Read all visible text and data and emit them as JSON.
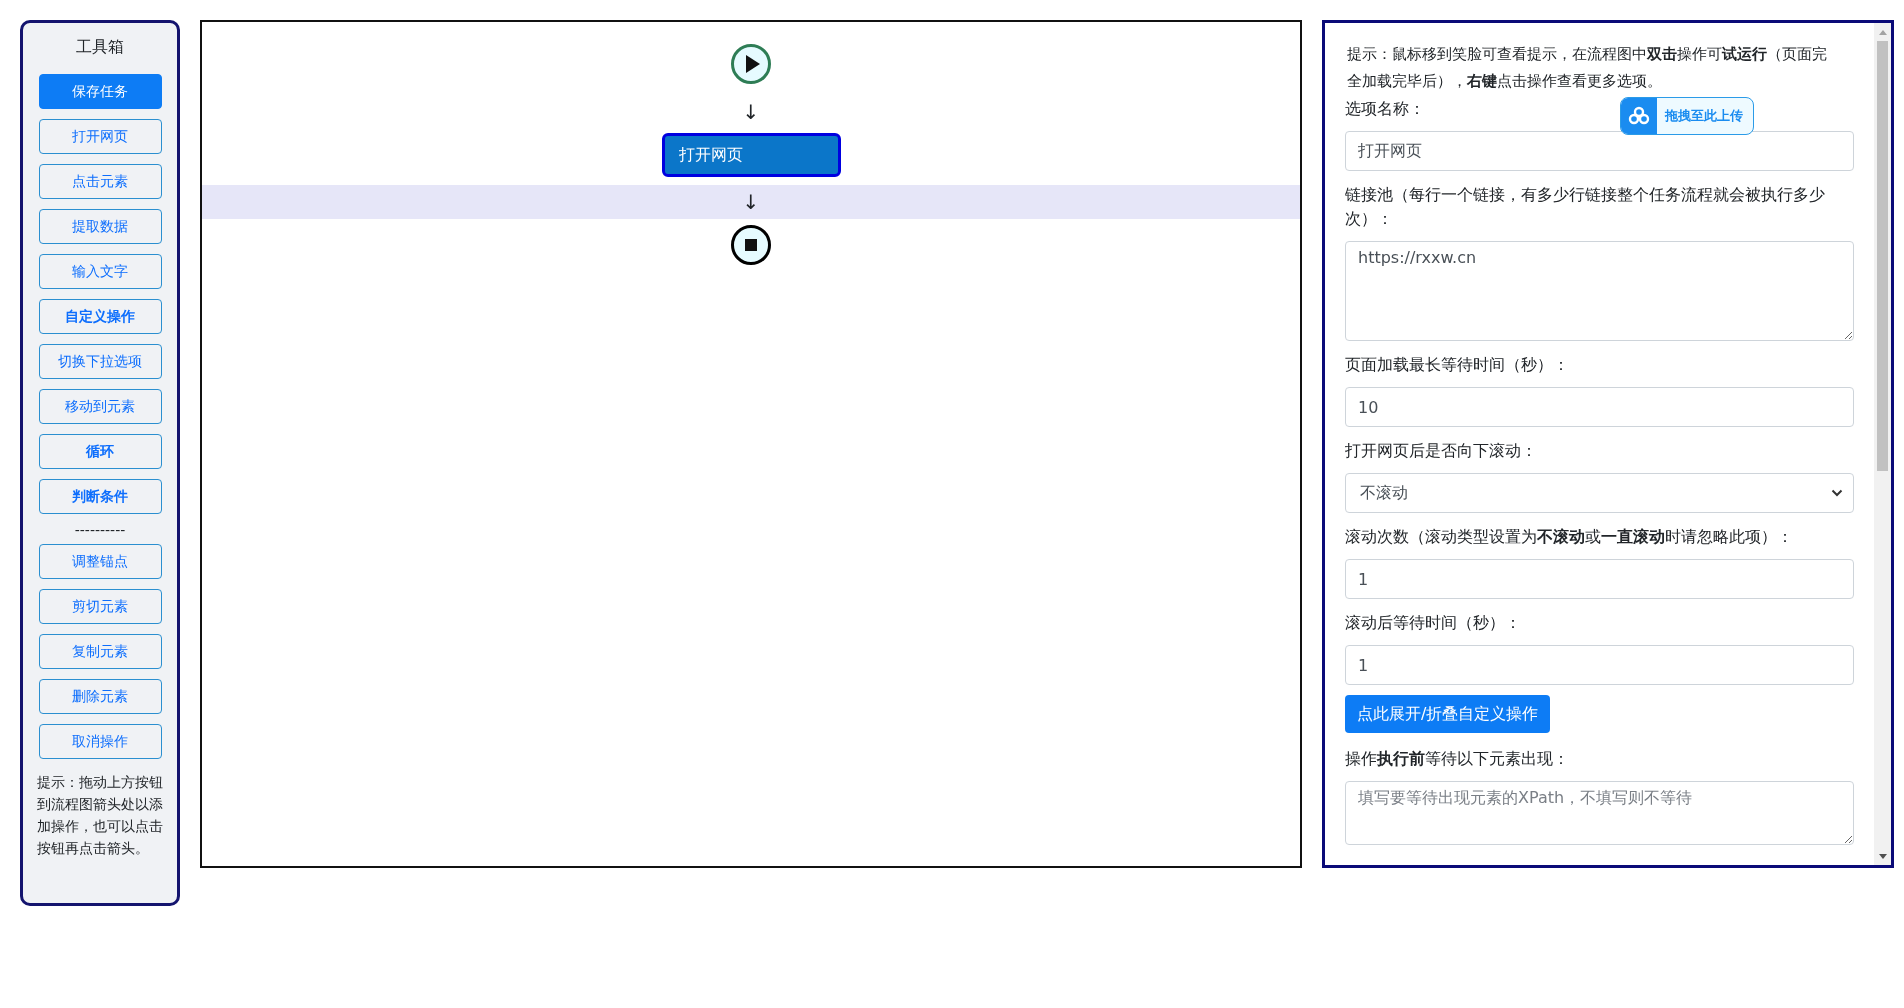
{
  "toolbox": {
    "title": "工具箱",
    "items": [
      {
        "kind": "button",
        "label": "保存任务",
        "primary": true,
        "bold": false
      },
      {
        "kind": "button",
        "label": "打开网页",
        "primary": false,
        "bold": false
      },
      {
        "kind": "button",
        "label": "点击元素",
        "primary": false,
        "bold": false
      },
      {
        "kind": "button",
        "label": "提取数据",
        "primary": false,
        "bold": false
      },
      {
        "kind": "button",
        "label": "输入文字",
        "primary": false,
        "bold": false
      },
      {
        "kind": "button",
        "label": "自定义操作",
        "primary": false,
        "bold": true
      },
      {
        "kind": "button",
        "label": "切换下拉选项",
        "primary": false,
        "bold": false
      },
      {
        "kind": "button",
        "label": "移动到元素",
        "primary": false,
        "bold": false
      },
      {
        "kind": "button",
        "label": "循环",
        "primary": false,
        "bold": true
      },
      {
        "kind": "button",
        "label": "判断条件",
        "primary": false,
        "bold": true
      },
      {
        "kind": "divider",
        "label": "----------"
      },
      {
        "kind": "button",
        "label": "调整锚点",
        "primary": false,
        "bold": false
      },
      {
        "kind": "button",
        "label": "剪切元素",
        "primary": false,
        "bold": false
      },
      {
        "kind": "button",
        "label": "复制元素",
        "primary": false,
        "bold": false
      },
      {
        "kind": "button",
        "label": "删除元素",
        "primary": false,
        "bold": false
      },
      {
        "kind": "button",
        "label": "取消操作",
        "primary": false,
        "bold": false
      }
    ],
    "hint": "提示：拖动上方按钮到流程图箭头处以添加操作，也可以点击按钮再点击箭头。"
  },
  "flow": [
    {
      "kind": "start"
    },
    {
      "kind": "arrow",
      "symbol": "↓",
      "highlighted": false
    },
    {
      "kind": "action",
      "label": "打开网页",
      "selected": true
    },
    {
      "kind": "arrow",
      "symbol": "↓",
      "highlighted": true
    },
    {
      "kind": "end"
    }
  ],
  "options": {
    "hint": "提示：鼠标移到笑脸可查看提示，在流程图中**双击**操作可**试运行**（页面完全加载完毕后），**右键**点击操作查看更多选项。",
    "upload_badge": {
      "label": "拖拽至此上传"
    },
    "fields": [
      {
        "kind": "input",
        "label": "选项名称：",
        "value": "打开网页"
      },
      {
        "kind": "textarea",
        "label": "链接池（每行一个链接，有多少行链接整个任务流程就会被执行多少次）：",
        "value": "https://rxxw.cn"
      },
      {
        "kind": "input",
        "label": "页面加载最长等待时间（秒）：",
        "value": "10"
      },
      {
        "kind": "select",
        "label": "打开网页后是否向下滚动：",
        "value": "不滚动"
      },
      {
        "kind": "input",
        "label": "滚动次数（滚动类型设置为**不滚动**或**一直滚动**时请忽略此项）：",
        "value": "1"
      },
      {
        "kind": "input",
        "label": "滚动后等待时间（秒）：",
        "value": "1"
      },
      {
        "kind": "button",
        "label": "点此展开/折叠自定义操作"
      },
      {
        "kind": "textarea",
        "label": "操作**执行前**等待以下元素出现：",
        "placeholder": "填写要等待出现元素的XPath，不填写则不等待"
      }
    ]
  }
}
